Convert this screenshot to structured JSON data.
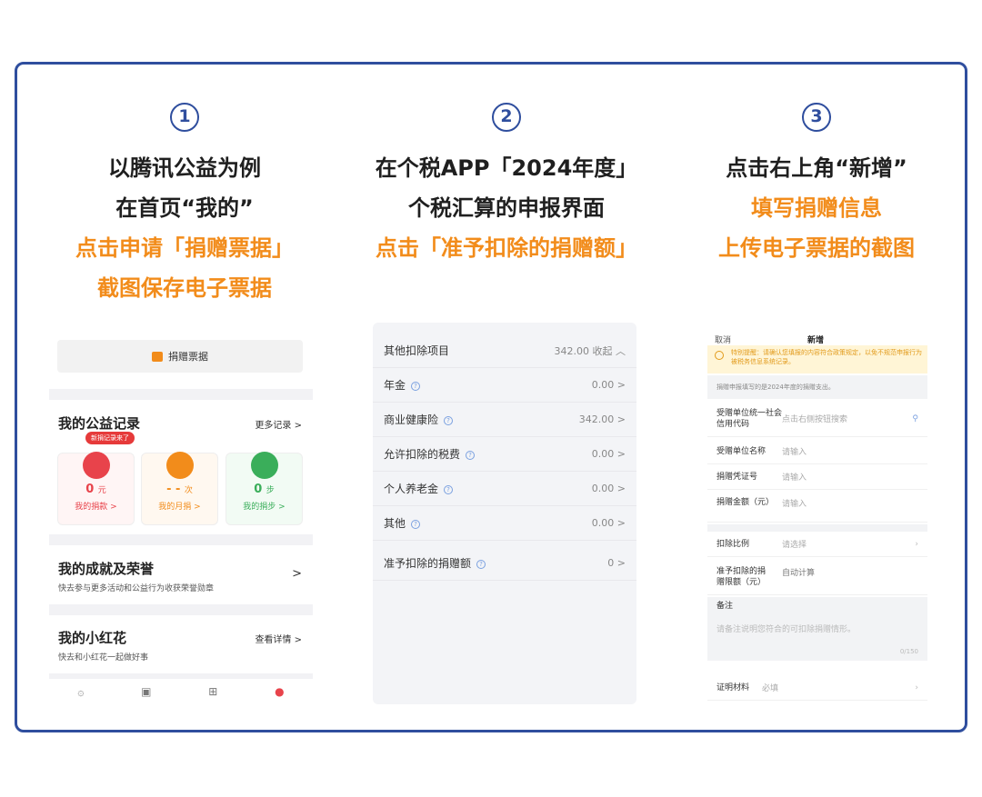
{
  "steps": [
    {
      "num": "1",
      "lines": [
        "以腾讯公益为例",
        "在首页“我的”"
      ],
      "highlight": [
        "点击申请「捐赠票据」"
      ],
      "extra": [
        "截图保存电子票据"
      ]
    },
    {
      "num": "2",
      "lines": [
        "在个税APP「2024年度」",
        "个税汇算的申报界面"
      ],
      "highlight": [
        "点击「准予扣除的捐赠额」"
      ],
      "extra": []
    },
    {
      "num": "3",
      "lines": [
        "点击右上角“新增”"
      ],
      "highlight": [
        "填写捐赠信息",
        "上传电子票据的截图"
      ],
      "extra": []
    }
  ],
  "panel1": {
    "tip_button": "捐赠票据",
    "records_title": "我的公益记录",
    "records_more": "更多记录 >",
    "badge": "新捐记录来了",
    "cards": [
      {
        "value": "0",
        "unit": "元",
        "label": "我的捐款 >",
        "color": "#e8434b"
      },
      {
        "value": "- -",
        "unit": "次",
        "label": "我的月捐 >",
        "color": "#f28c1b"
      },
      {
        "value": "0",
        "unit": "步",
        "label": "我的捐步 >",
        "color": "#3aae5a"
      }
    ],
    "honor_title": "我的成就及荣誉",
    "honor_sub": "快去参与更多活动和公益行为收获荣誉勋章",
    "honor_arrow": ">",
    "flower_title": "我的小红花",
    "flower_sub": "快去和小红花一起做好事",
    "flower_link": "查看详情 >"
  },
  "panel2": {
    "rows": [
      {
        "label": "其他扣除项目",
        "value": "342.00 收起 ︿",
        "q": false
      },
      {
        "label": "年金",
        "value": "0.00  >",
        "q": true
      },
      {
        "label": "商业健康险",
        "value": "342.00  >",
        "q": true
      },
      {
        "label": "允许扣除的税费",
        "value": "0.00  >",
        "q": true
      },
      {
        "label": "个人养老金",
        "value": "0.00  >",
        "q": true
      },
      {
        "label": "其他",
        "value": "0.00  >",
        "q": true
      },
      {
        "label": "准予扣除的捐赠额",
        "value": "0  >",
        "q": true
      }
    ]
  },
  "panel3": {
    "cancel": "取消",
    "title": "新增",
    "warning": "特别提醒：请确认您填报的内容符合政策规定，以免不规范申报行为被税务信息系统记录。",
    "info": "捐赠申报填写的是2024年度的捐赠支出。",
    "fields": [
      {
        "k": "受赠单位统一社会信用代码",
        "v": "点击右侧按钮搜索"
      },
      {
        "k": "受赠单位名称",
        "v": "请输入"
      },
      {
        "k": "捐赠凭证号",
        "v": "请输入"
      },
      {
        "k": "捐赠金额（元）",
        "v": "请输入"
      },
      {
        "k": "扣除比例",
        "v": "请选择"
      },
      {
        "k": "准予扣除的捐赠限额（元）",
        "v": "自动计算"
      }
    ],
    "remark_label": "备注",
    "remark_placeholder": "请备注说明您符合的可扣除捐赠情形。",
    "counter": "0/150",
    "proof_label": "证明材料",
    "proof_value": "必填"
  }
}
